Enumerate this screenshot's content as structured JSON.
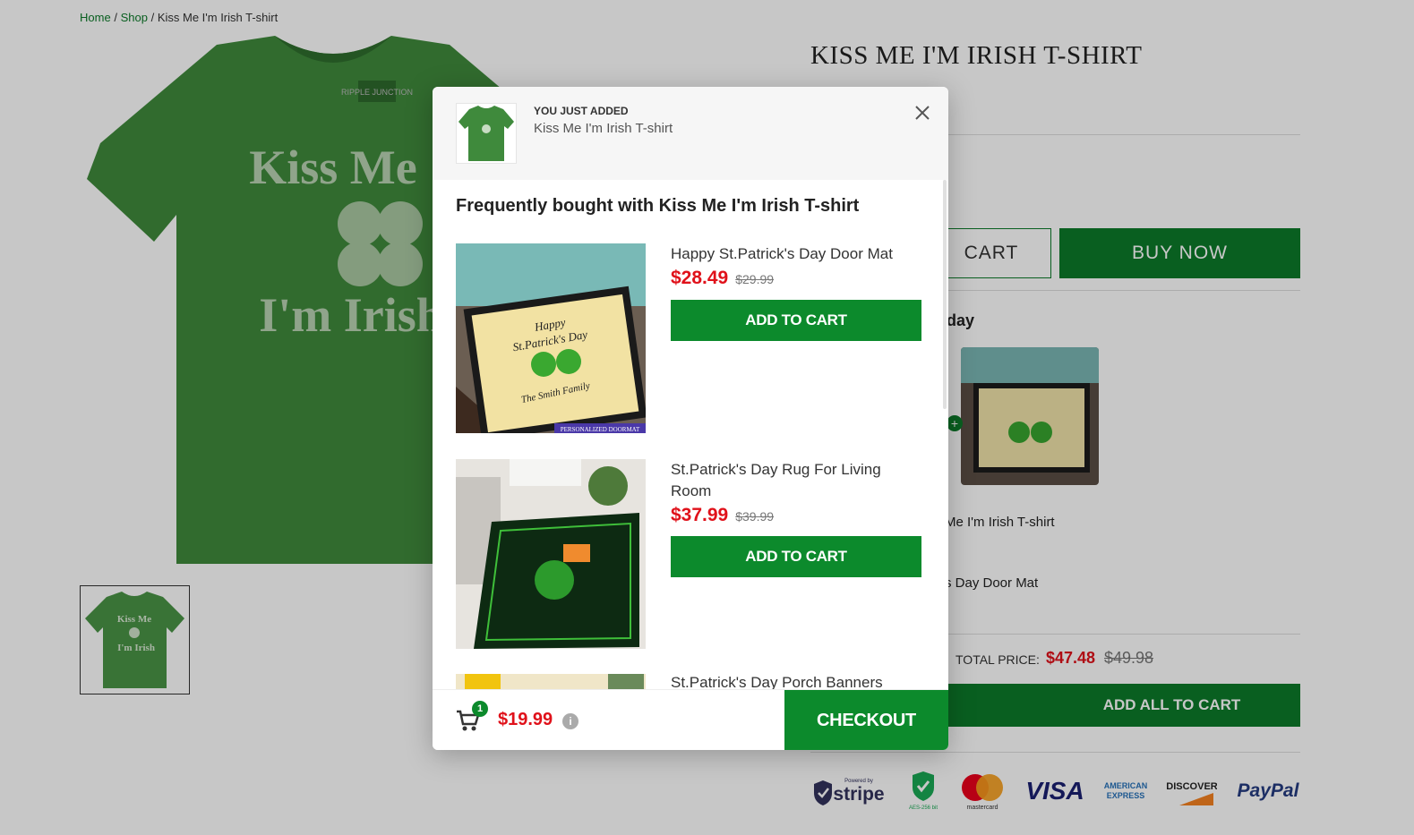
{
  "breadcrumb": {
    "home": "Home",
    "sep1": "/",
    "shop": "Shop",
    "sep2": "/",
    "current": "Kiss Me I'm Irish T-shirt"
  },
  "product": {
    "title": "KISS ME I'M IRISH T-SHIRT",
    "shirt_text_top": "Kiss Me",
    "shirt_text_bottom": "I'm Irish",
    "shirt_brand": "RIPPLE JUNCTION",
    "thumb_text_top": "Kiss Me",
    "thumb_text_bottom": "I'm Irish"
  },
  "buttons": {
    "add_to_cart_partial": "CART",
    "buy_now": "BUY NOW",
    "add_all": "ADD ALL TO CART"
  },
  "fbt_section": {
    "heading_partial": "day",
    "plus": "+",
    "item1_partial": "Me I'm Irish T-shirt",
    "item2_partial": "s Day Door Mat",
    "total_label": "TOTAL PRICE:",
    "total_price": "$47.48",
    "total_old": "$49.98"
  },
  "payments": {
    "stripe_powered": "Powered by",
    "stripe": "stripe",
    "aes": "AES-256 bit",
    "mastercard": "mastercard",
    "visa": "VISA",
    "amex1": "AMERICAN",
    "amex2": "EXPRESS",
    "discover": "DISCOVER",
    "paypal": "PayPal"
  },
  "colors": {
    "brand_green": "#0c7a29",
    "button_green": "#0c8a2c",
    "price_red": "#e0111a",
    "shirt_green": "#3f8a3c"
  },
  "modal": {
    "added_label": "YOU JUST ADDED",
    "added_name": "Kiss Me I'm Irish T-shirt",
    "close_icon": "close-icon",
    "fbt_title": "Frequently bought with Kiss Me I'm Irish T-shirt",
    "items": [
      {
        "title": "Happy St.Patrick's Day Door Mat",
        "price": "$28.49",
        "old_price": "$29.99",
        "button": "ADD TO CART",
        "img_line1": "Happy",
        "img_line2": "St.Patrick's Day",
        "img_line3": "The Smith Family",
        "img_tag": "PERSONALIZED DOORMAT"
      },
      {
        "title": "St.Patrick's Day Rug For Living Room",
        "price": "$37.99",
        "old_price": "$39.99",
        "button": "ADD TO CART"
      },
      {
        "title": "St.Patrick's Day Porch Banners"
      }
    ],
    "footer": {
      "cart_count": "1",
      "total": "$19.99",
      "info": "i",
      "checkout": "CHECKOUT"
    }
  }
}
